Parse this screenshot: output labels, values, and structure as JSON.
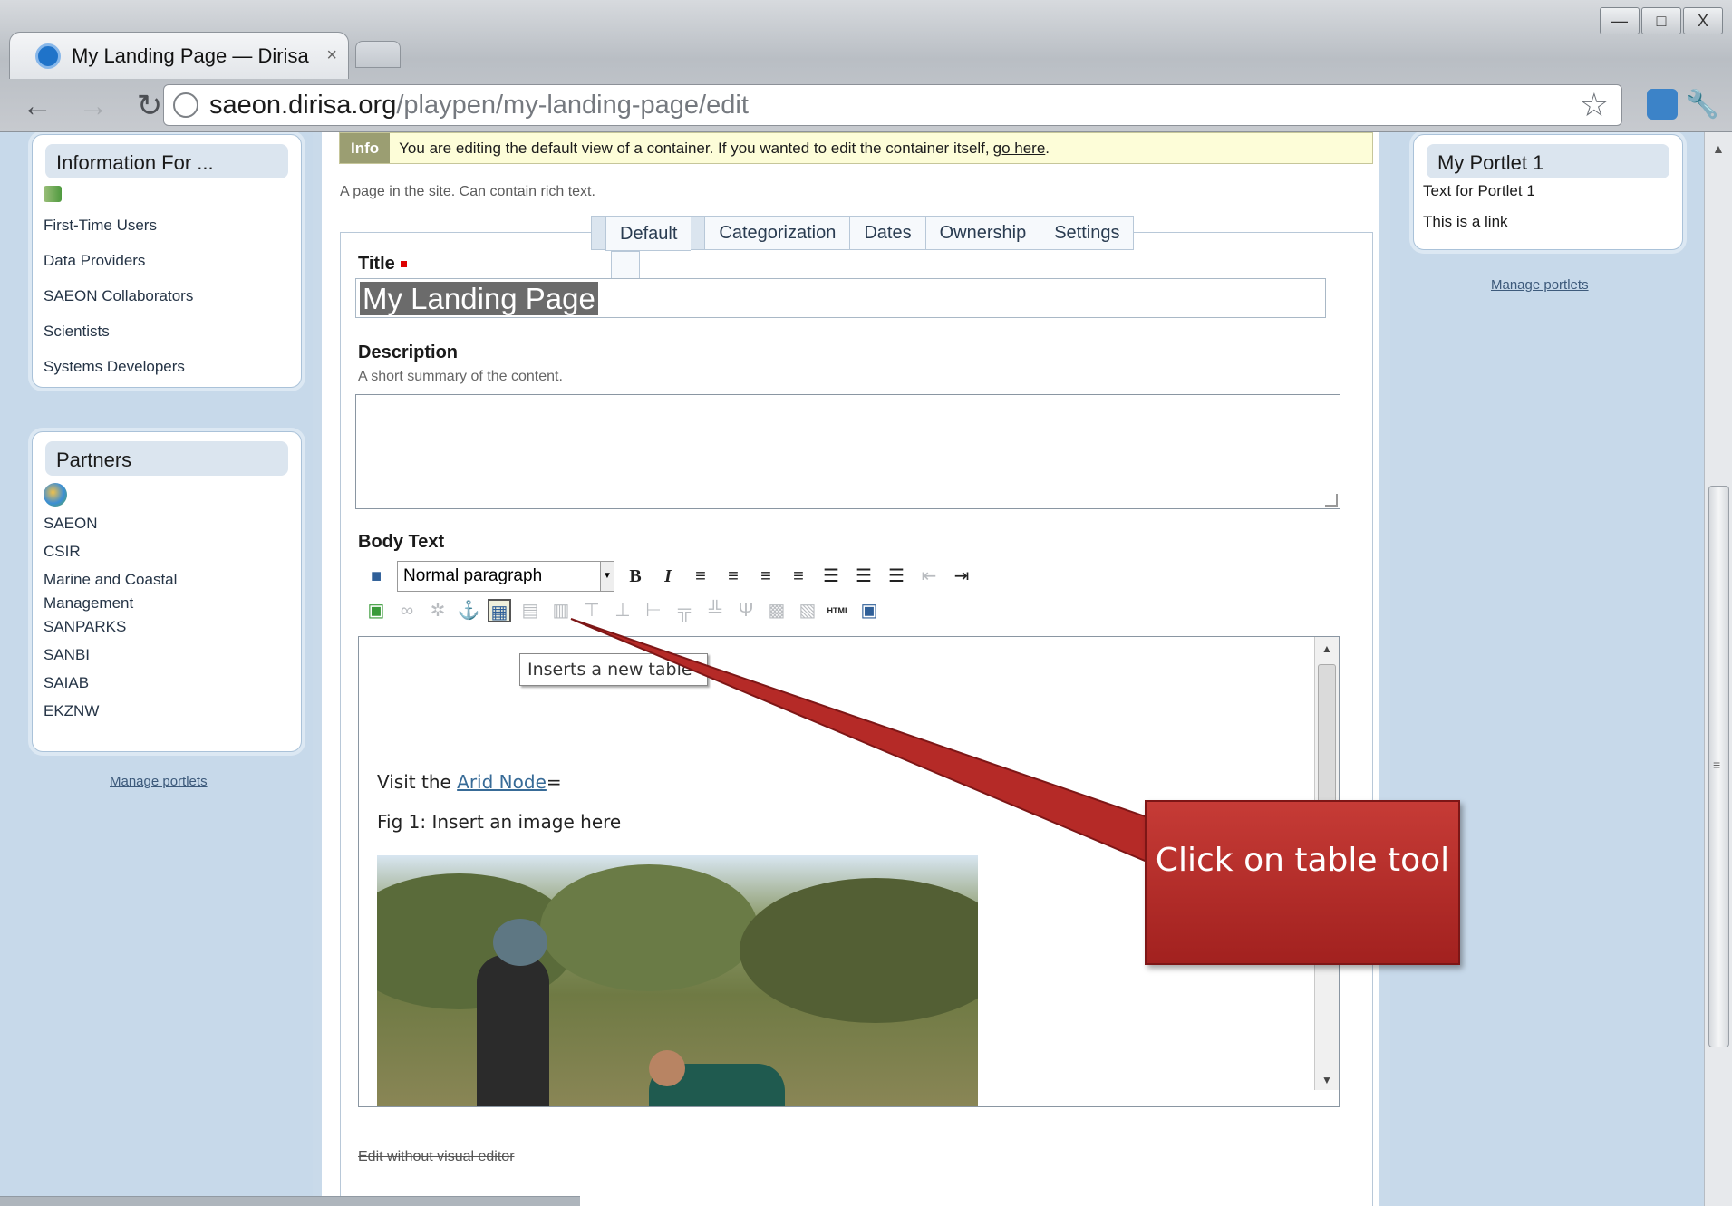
{
  "browser": {
    "tab_title": "My Landing Page — Dirisa",
    "tab_close": "×",
    "url_domain": "saeon.dirisa.org",
    "url_path": "/playpen/my-landing-page/edit",
    "win_min": "—",
    "win_max": "□",
    "win_close": "X"
  },
  "left_portlets": {
    "info_title": "Information For ...",
    "info_items": [
      "First-Time Users",
      "Data Providers",
      "SAEON Collaborators",
      "Scientists",
      "Systems Developers"
    ],
    "partners_title": "Partners",
    "partner_items": [
      "SAEON",
      "CSIR",
      "Marine and Coastal Management",
      "SANPARKS",
      "SANBI",
      "SAIAB",
      "EKZNW"
    ],
    "manage": "Manage portlets"
  },
  "right_portlets": {
    "title": "My Portlet 1",
    "text": "Text for Portlet 1",
    "link": "This is a link",
    "manage": "Manage portlets"
  },
  "main": {
    "info_badge": "Info",
    "info_text": "You are editing the default view of a container. If you wanted to edit the container itself,",
    "info_link": "go here",
    "info_end": ".",
    "page_desc": "A page in the site. Can contain rich text.",
    "tabs": [
      "Default",
      "Categorization",
      "Dates",
      "Ownership",
      "Settings"
    ],
    "title_label": "Title",
    "title_value": "My Landing Page",
    "description_label": "Description",
    "description_help": "A short summary of the content.",
    "body_label": "Body Text",
    "paragraph_style": "Normal paragraph",
    "tooltip": "Inserts a new table",
    "visit_text": "Visit the ",
    "arid_link": "Arid Node",
    "visit_end": "=",
    "fig_caption": "Fig 1: Insert an image here",
    "edit_without": "Edit without visual editor"
  },
  "callout": {
    "text": "Click on table tool",
    "color": "#b52a27"
  }
}
